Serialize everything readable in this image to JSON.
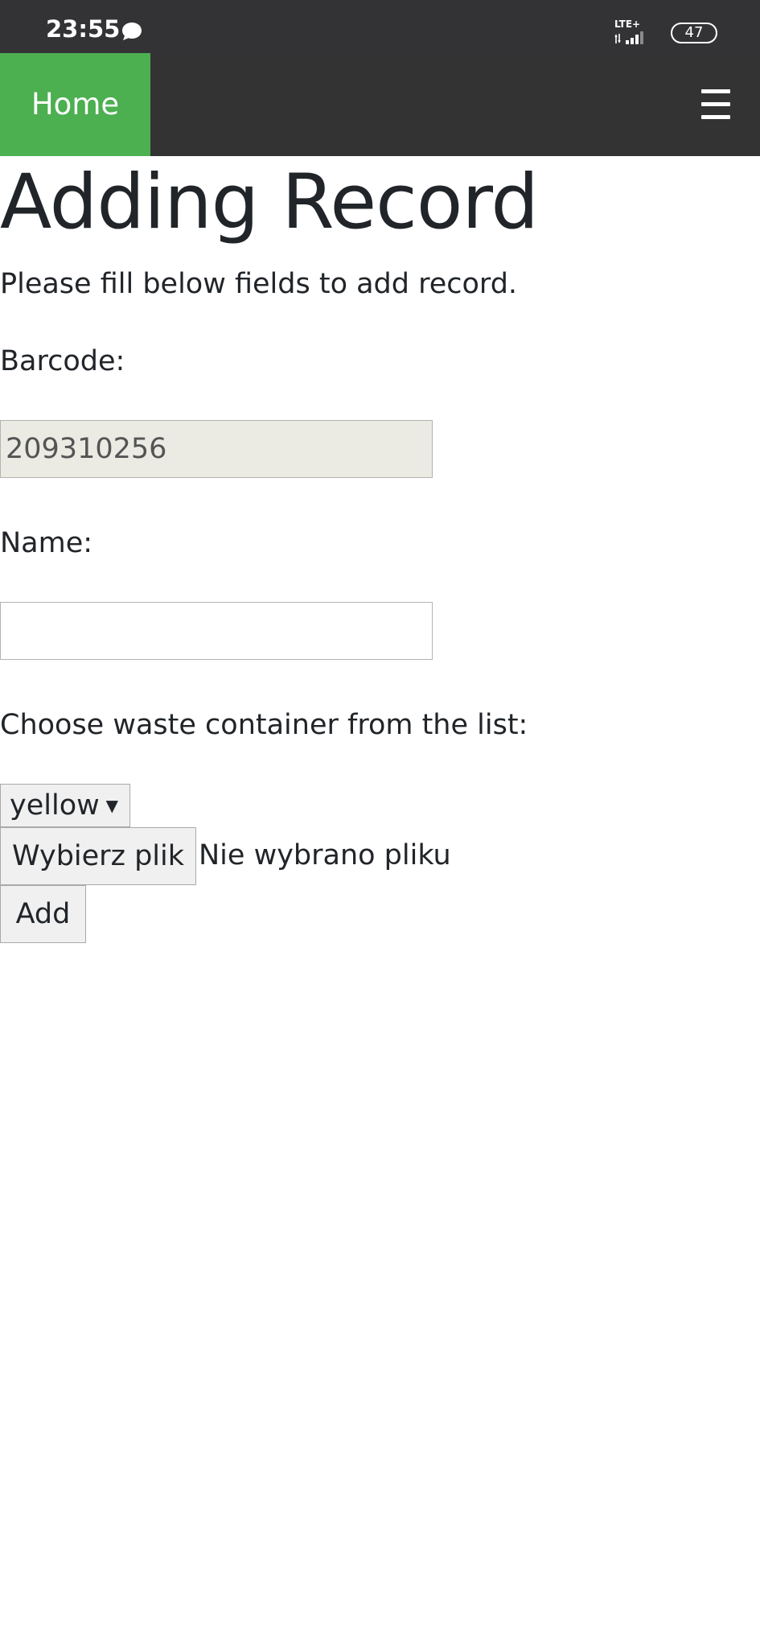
{
  "status_bar": {
    "time": "23:55",
    "network": "LTE+",
    "battery": "47",
    "icons": [
      "chat-bubble-icon",
      "signal-icon",
      "battery-icon"
    ]
  },
  "navbar": {
    "home_label": "Home",
    "menu_icon": "hamburger-menu-icon",
    "home_color": "#4caf50",
    "bar_color": "#333333"
  },
  "page": {
    "title": "Adding Record",
    "intro": "Please fill below fields to add record."
  },
  "form": {
    "barcode_label": "Barcode:",
    "barcode_value": "209310256",
    "name_label": "Name:",
    "name_value": "",
    "container_label": "Choose waste container from the list:",
    "container_selected": "yellow",
    "file_button_label": "Wybierz plik",
    "file_status": "Nie wybrano pliku",
    "add_button_label": "Add"
  }
}
